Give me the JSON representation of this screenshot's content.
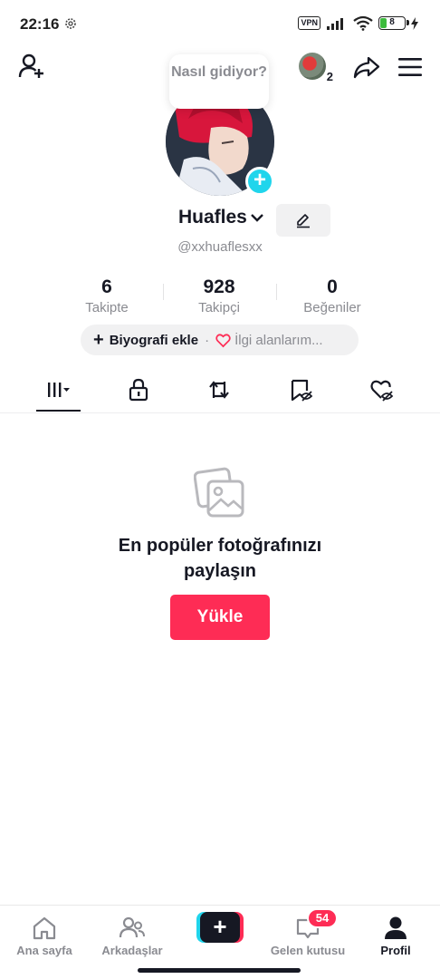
{
  "status_bar": {
    "time": "22:16",
    "vpn_label": "VPN",
    "battery_level": "8",
    "battery_color": "#3dbb3d"
  },
  "header": {
    "add_friend_icon": "person-plus-icon",
    "friend_notification_count": "2",
    "share_icon": "share-arrow-icon",
    "menu_icon": "hamburger-menu-icon"
  },
  "profile": {
    "bubble_text": "Nasıl gidiyor?",
    "username": "Huafles",
    "handle": "@xxhuaflesxx",
    "stats": [
      {
        "value": "6",
        "label": "Takipte"
      },
      {
        "value": "928",
        "label": "Takipçi"
      },
      {
        "value": "0",
        "label": "Beğeniler"
      }
    ],
    "bio_add_label": "Biyografi ekle",
    "bio_separator": "·",
    "interests_label": "İlgi alanlarım..."
  },
  "tabs": [
    {
      "icon": "videos-grid-icon",
      "active": true
    },
    {
      "icon": "lock-icon",
      "active": false
    },
    {
      "icon": "repost-icon",
      "active": false
    },
    {
      "icon": "saved-hidden-icon",
      "active": false
    },
    {
      "icon": "liked-hidden-icon",
      "active": false
    }
  ],
  "empty_state": {
    "icon": "photos-icon",
    "title_line1": "En popüler fotoğrafınızı",
    "title_line2": "paylaşın",
    "upload_label": "Yükle"
  },
  "bottom_nav": {
    "home_label": "Ana sayfa",
    "friends_label": "Arkadaşlar",
    "create_label": "+",
    "inbox_label": "Gelen kutusu",
    "inbox_badge": "54",
    "profile_label": "Profil"
  },
  "colors": {
    "accent_pink": "#fe2c55",
    "accent_cyan": "#20d5ec",
    "text_primary": "#161823",
    "text_secondary": "#8a8b91"
  }
}
